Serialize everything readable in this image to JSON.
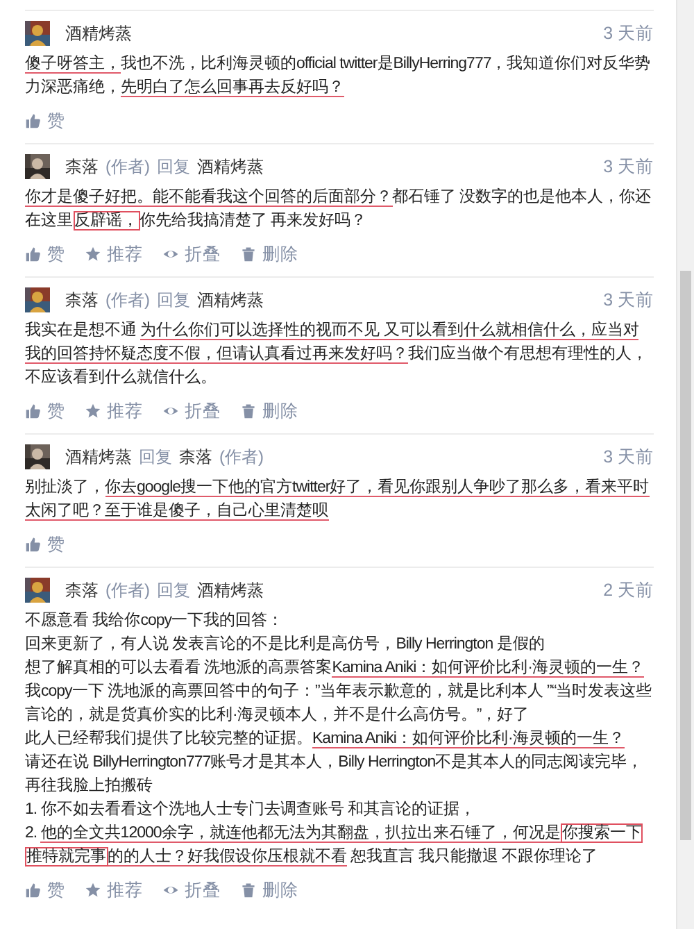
{
  "comments": [
    {
      "author": "酒精烤蒸",
      "time": "3 天前",
      "body": [
        [
          {
            "text": "傻子呀答主，",
            "underlined": true,
            "boxed": false
          },
          {
            "text": "我也不洗，比利海灵顿的official twitter是BillyHerring777，我知道你们对反华势力深恶痛绝，",
            "underlined": false,
            "boxed": false
          },
          {
            "text": "先明白了怎么回事再去反好吗？",
            "underlined": true,
            "boxed": false
          }
        ]
      ],
      "actions": [
        {
          "kind": "like",
          "label": "赞"
        }
      ]
    },
    {
      "author": "柰落",
      "author_tag": "(作者)",
      "reply_label": "回复",
      "reply_to": "酒精烤蒸",
      "time": "3 天前",
      "body": [
        [
          {
            "text": "你才是傻子好把。能不能看我这个回答的后面部分？",
            "underlined": true,
            "boxed": false
          },
          {
            "text": "都石锤了 没数字的也是他本人，你还在这里",
            "underlined": false,
            "boxed": false
          },
          {
            "text": "反辟谣，",
            "underlined": false,
            "boxed": true
          },
          {
            "text": "你先给我搞清楚了 再来发好吗？",
            "underlined": false,
            "boxed": false
          }
        ]
      ],
      "actions": [
        {
          "kind": "like",
          "label": "赞"
        },
        {
          "kind": "recommend",
          "label": "推荐"
        },
        {
          "kind": "fold",
          "label": "折叠"
        },
        {
          "kind": "delete",
          "label": "删除"
        }
      ]
    },
    {
      "author": "柰落",
      "author_tag": "(作者)",
      "reply_label": "回复",
      "reply_to": "酒精烤蒸",
      "time": "3 天前",
      "body": [
        [
          {
            "text": "我实在是想不通 ",
            "underlined": false,
            "boxed": false
          },
          {
            "text": "为什么你们可以选择性的视而不见 又可以看到什么就相信什么，应当对我的回答持怀疑态度不假，但请认真看过再来发好吗？",
            "underlined": true,
            "boxed": false
          },
          {
            "text": "我们应当做个有思想有理性的人，不应该看到什么就信什么。",
            "underlined": false,
            "boxed": false
          }
        ]
      ],
      "actions": [
        {
          "kind": "like",
          "label": "赞"
        },
        {
          "kind": "recommend",
          "label": "推荐"
        },
        {
          "kind": "fold",
          "label": "折叠"
        },
        {
          "kind": "delete",
          "label": "删除"
        }
      ]
    },
    {
      "author": "酒精烤蒸",
      "reply_label": "回复",
      "reply_to": "柰落",
      "reply_to_tag": "(作者)",
      "time": "3 天前",
      "body": [
        [
          {
            "text": "别扯淡了，",
            "underlined": false,
            "boxed": false
          },
          {
            "text": "你去google搜一下他的官方twitter好了，看见你跟别人争吵了那么多，看来平时太闲了吧？至于谁是傻子，自己心里清楚呗",
            "underlined": true,
            "boxed": false
          }
        ]
      ],
      "actions": [
        {
          "kind": "like",
          "label": "赞"
        }
      ]
    },
    {
      "author": "柰落",
      "author_tag": "(作者)",
      "reply_label": "回复",
      "reply_to": "酒精烤蒸",
      "time": "2 天前",
      "body": [
        [
          {
            "text": "不愿意看 我给你copy一下我的回答：",
            "underlined": false,
            "boxed": false
          }
        ],
        [
          {
            "text": "回来更新了，有人说 发表言论的不是比利是高仿号，Billy Herrington 是假的",
            "underlined": false,
            "boxed": false
          }
        ],
        [
          {
            "text": "想了解真相的可以去看看 洗地派的高票答案",
            "underlined": false,
            "boxed": false
          },
          {
            "text": "Kamina Aniki：如何评价比利·海灵顿的一生？",
            "underlined": true,
            "boxed": false
          }
        ],
        [
          {
            "text": "我copy一下 洗地派的高票回答中的句子：”当年表示歉意的，就是比利本人 ”“当时发表这些言论的，就是货真价实的比利·海灵顿本人，并不是什么高仿号。”，好了",
            "underlined": false,
            "boxed": false
          }
        ],
        [
          {
            "text": "此人已经帮我们提供了比较完整的证据。",
            "underlined": false,
            "boxed": false
          },
          {
            "text": "Kamina Aniki：如何评价比利·海灵顿的一生？",
            "underlined": true,
            "boxed": false
          }
        ],
        [
          {
            "text": "请还在说 BillyHerrington777账号才是其本人，Billy Herrington不是其本人的同志阅读完毕，再往我脸上拍搬砖",
            "underlined": false,
            "boxed": false
          }
        ],
        [
          {
            "text": "1. 你不如去看看这个洗地人士专门去调查账号 和其言论的证据，",
            "underlined": false,
            "boxed": false
          }
        ],
        [
          {
            "text": "2. ",
            "underlined": false,
            "boxed": false
          },
          {
            "text": "他的全文共12000余字，就连他都无法为其翻盘，扒拉出来石锤了，何况是",
            "underlined": true,
            "boxed": false
          },
          {
            "text": "你搜索一下推特就完事",
            "underlined": true,
            "boxed": true
          },
          {
            "text": "的的人士？好我假设你压根就不看",
            "underlined": true,
            "boxed": false
          },
          {
            "text": " 恕我直言 我只能撤退 不跟你理论了",
            "underlined": false,
            "boxed": false
          }
        ]
      ],
      "actions": [
        {
          "kind": "like",
          "label": "赞"
        },
        {
          "kind": "recommend",
          "label": "推荐"
        },
        {
          "kind": "fold",
          "label": "折叠"
        },
        {
          "kind": "delete",
          "label": "删除"
        }
      ]
    }
  ]
}
